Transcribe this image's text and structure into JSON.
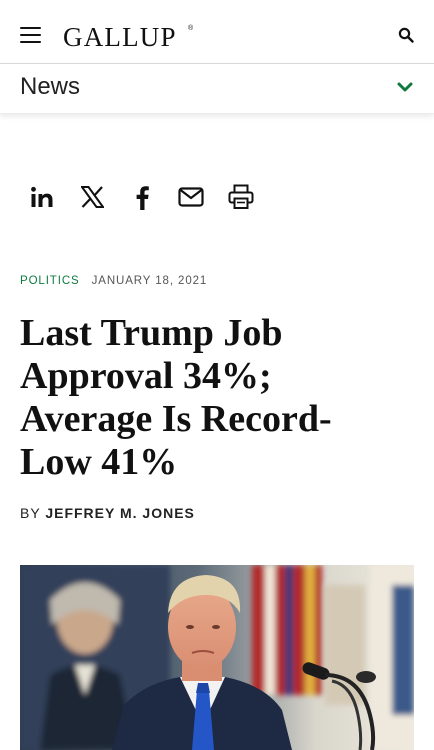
{
  "header": {
    "logo": "GALLUP",
    "logo_mark": "®",
    "menu_icon": "hamburger-menu-icon",
    "search_icon": "search-icon"
  },
  "subnav": {
    "label": "News",
    "toggle_icon": "chevron-down-icon",
    "accent_color": "#0f7a3d"
  },
  "share": {
    "items": [
      {
        "name": "linkedin",
        "icon": "linkedin-icon"
      },
      {
        "name": "x",
        "icon": "x-icon"
      },
      {
        "name": "facebook",
        "icon": "facebook-icon"
      },
      {
        "name": "email",
        "icon": "mail-icon"
      },
      {
        "name": "print",
        "icon": "printer-icon"
      }
    ]
  },
  "article": {
    "category": "POLITICS",
    "date": "JANUARY 18, 2021",
    "headline_lines": [
      "Last Trump Job",
      "Approval 34%;",
      "Average Is Record-",
      "Low 41%"
    ],
    "byline_prefix": "BY",
    "author": "JEFFREY M. JONES",
    "category_color": "#0f7a3d"
  }
}
